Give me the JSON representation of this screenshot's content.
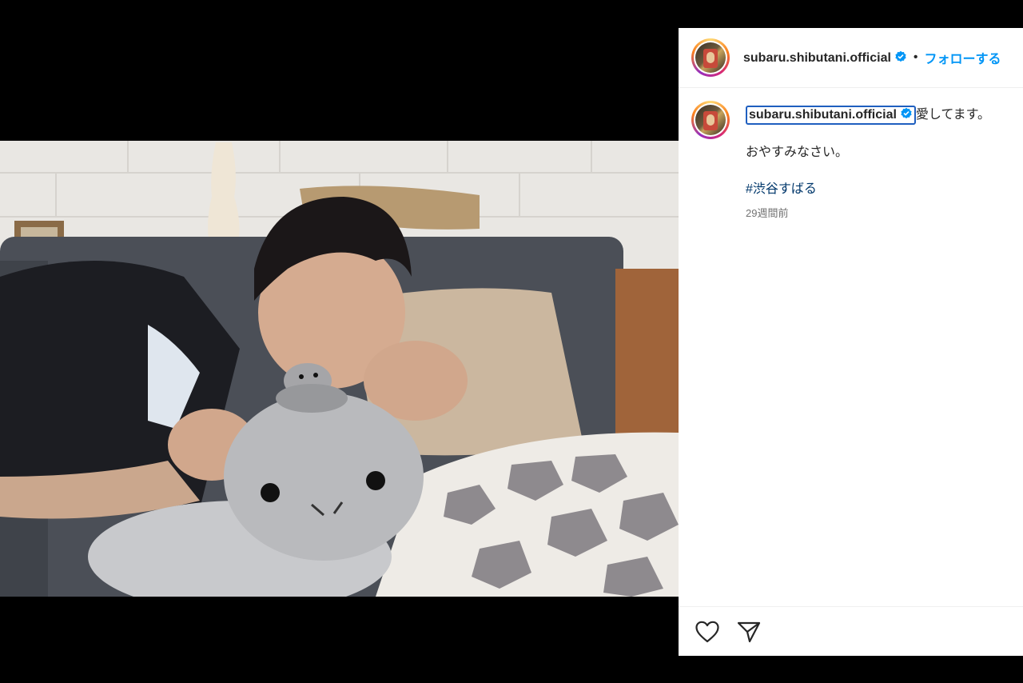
{
  "post": {
    "photo_alt": "man lying on sofa with plush turtle",
    "author": {
      "username": "subaru.shibutani.official",
      "verified": true,
      "follow_label": "フォローする"
    },
    "caption": {
      "username": "subaru.shibutani.official",
      "line1": "愛してます。",
      "line2": "おやすみなさい。",
      "hashtag": "#渋谷すばる",
      "timestamp": "29週間前"
    },
    "actions": {
      "like_icon": "heart-icon",
      "share_icon": "paper-plane-icon"
    },
    "colors": {
      "follow": "#0095f6",
      "hashtag": "#00376b",
      "verified": "#0095f6"
    }
  }
}
